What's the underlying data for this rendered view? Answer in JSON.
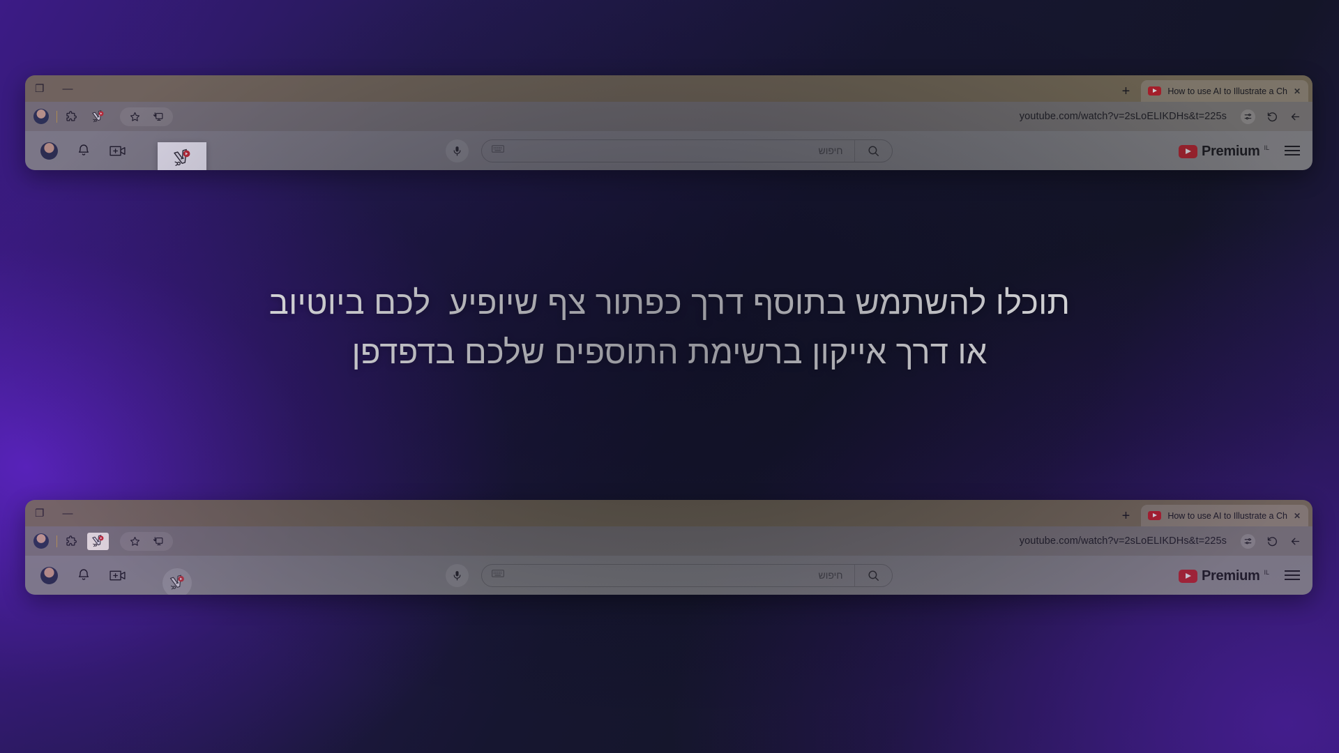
{
  "slide": {
    "background_from": "#3c1b86",
    "background_mid": "#161630",
    "background_to": "#2a1a5e",
    "headline_line1": "תוכלו להשתמש בתוסף דרך כפתור צף שיופיע  לכם ביוטיוב",
    "headline_line2": "או דרך אייקון ברשימת התוספים שלכם בדפדפן",
    "headline_color": "#ffffff"
  },
  "browser_top": {
    "window_controls": {
      "restore_label": "❐",
      "minimize_label": "—"
    },
    "new_tab_label": "+",
    "tab": {
      "close_label": "✕",
      "title": "How to use AI to Illustrate a Ch",
      "favicon": "youtube-favicon"
    },
    "toolbar": {
      "url": "youtube.com/watch?v=2sLoELIKDHs&t=225s",
      "permission_chip": "site-settings-icon",
      "reload_label": "⟲",
      "back_label": "←",
      "profile_icon": "profile-avatar-icon",
      "extensions_icon": "extensions-puzzle-icon",
      "pinned_extension_icon": "extension-logo-icon",
      "bookmark_icon": "bookmark-star-icon",
      "install_icon": "install-app-icon"
    },
    "youtube": {
      "avatar": "channel-avatar",
      "notifications_icon": "bell-icon",
      "create_icon": "create-video-icon",
      "search_placeholder": "חיפוש",
      "search_value": "",
      "keyboard_icon": "keyboard-icon",
      "search_icon": "magnifier-icon",
      "mic_icon": "microphone-icon",
      "premium_word": "Premium",
      "premium_region": "IL",
      "menu_icon": "hamburger-menu-icon",
      "extension_card_icon": "extension-logo-icon"
    }
  },
  "browser_bottom": {
    "window_controls": {
      "restore_label": "❐",
      "minimize_label": "—"
    },
    "new_tab_label": "+",
    "tab": {
      "close_label": "✕",
      "title": "How to use AI to Illustrate a Ch",
      "favicon": "youtube-favicon"
    },
    "toolbar": {
      "url": "youtube.com/watch?v=2sLoELIKDHs&t=225s",
      "permission_chip": "site-settings-icon",
      "reload_label": "⟲",
      "back_label": "←",
      "profile_icon": "profile-avatar-icon",
      "extensions_icon": "extensions-puzzle-icon",
      "pinned_extension_icon": "extension-logo-icon",
      "bookmark_icon": "bookmark-star-icon",
      "install_icon": "install-app-icon"
    },
    "youtube": {
      "avatar": "channel-avatar",
      "notifications_icon": "bell-icon",
      "create_icon": "create-video-icon",
      "search_placeholder": "חיפוש",
      "search_value": "",
      "keyboard_icon": "keyboard-icon",
      "search_icon": "magnifier-icon",
      "mic_icon": "microphone-icon",
      "premium_word": "Premium",
      "premium_region": "IL",
      "menu_icon": "hamburger-menu-icon",
      "floating_button_icon": "extension-logo-icon"
    }
  }
}
